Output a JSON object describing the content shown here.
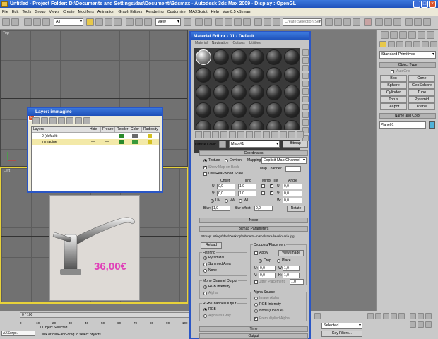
{
  "app": {
    "title": "Untitled   - Project Folder: D:\\Documents and Settings\\das\\Documenti\\3dsmax   - Autodesk 3ds Max  2009   - Display : OpenGL"
  },
  "menu": [
    "File",
    "Edit",
    "Tools",
    "Group",
    "Views",
    "Create",
    "Modifiers",
    "Animation",
    "Graph Editors",
    "Rendering",
    "Customize",
    "MAXScript",
    "Help",
    "Vue 8.5 xStream"
  ],
  "toolbar": {
    "filter_value": "All",
    "view_value": "View",
    "selection_set_placeholder": "Create Selection Set"
  },
  "viewports": {
    "top_label": "Top",
    "left_label": "Left"
  },
  "product": {
    "price": "36,00€"
  },
  "command_panel": {
    "category": "Standard Primitives",
    "object_type_title": "Object Type",
    "autogrid": "AutoGrid",
    "buttons": [
      "Box",
      "Cone",
      "Sphere",
      "GeoSphere",
      "Cylinder",
      "Tube",
      "Torus",
      "Pyramid",
      "Teapot",
      "Plane"
    ],
    "name_color_title": "Name and Color",
    "name_value": "Plane01"
  },
  "material_editor": {
    "title": "Material Editor - 01 - Default",
    "menu": [
      "Material",
      "Navigation",
      "Options",
      "Utilities"
    ],
    "diffuse_label": "Diffuse Color:",
    "map_value": "Map #1",
    "bitmap_type": "Bitmap",
    "coordinates": {
      "title": "Coordinates",
      "texture": "Texture",
      "environ": "Environ",
      "mapping_label": "Mapping:",
      "mapping_value": "Explicit Map Channel",
      "show_map_on_back": "Show Map on Back",
      "map_channel_label": "Map Channel:",
      "map_channel_value": "1",
      "use_real_world": "Use Real-World Scale",
      "offset_label": "Offset",
      "tiling_label": "Tiling",
      "mirror_tile_label": "Mirror Tile",
      "angle_label": "Angle",
      "u_offset": "0,0",
      "v_offset": "0,0",
      "u_tiling": "1,0",
      "v_tiling": "1,0",
      "u_angle": "0,0",
      "v_angle": "0,0",
      "w_angle": "0,0",
      "u": "U:",
      "v": "V:",
      "w": "W:",
      "uv": "UV",
      "vw": "VW",
      "wu": "WU",
      "blur_label": "Blur:",
      "blur_value": "1,0",
      "blur_offset_label": "Blur offset:",
      "blur_offset_value": "0,0",
      "rotate": "Rotate"
    },
    "noise_title": "Noise",
    "bitmap_params": {
      "title": "Bitmap Parameters",
      "bitmap_path": "Bitmap:  ettings\\das\\Desktop\\rubinetto-miscelatore-lavello-aria.jpg",
      "reload": "Reload",
      "cropping_title": "Cropping/Placement",
      "apply": "Apply",
      "view_image": "View Image",
      "crop": "Crop",
      "place": "Place",
      "u_label": "U:",
      "w_label": "W:",
      "v_label": "V:",
      "h_label": "H:",
      "u_value": "0,0",
      "w_value": "1,0",
      "v_value": "0,0",
      "h_value": "1,0",
      "jitter": "Jitter Placement:",
      "jitter_value": "1,0",
      "filtering_title": "Filtering",
      "pyramidal": "Pyramidal",
      "summed_area": "Summed Area",
      "none": "None",
      "mono_title": "Mono Channel Output",
      "rgb_intensity": "RGB Intensity",
      "alpha": "Alpha",
      "rgb_channel_title": "RGB Channel Output",
      "rgb": "RGB",
      "alpha_as_gray": "Alpha as Gray",
      "alpha_source_title": "Alpha Source",
      "image_alpha": "Image Alpha",
      "rgb_intensity2": "RGB Intensity",
      "none_opaque": "None (Opaque)",
      "premultiplied": "Premultiplied Alpha"
    },
    "time_title": "Time",
    "output_title": "Output"
  },
  "layer_window": {
    "title": "Layer: immagine",
    "columns": [
      "Layers",
      "Hide",
      "Freeze",
      "Render",
      "Color",
      "Radiosity"
    ],
    "rows": [
      {
        "name": "0 (default)",
        "hide": "—",
        "freeze": "—"
      },
      {
        "name": "immagine",
        "hide": "—",
        "freeze": "—"
      }
    ]
  },
  "status": {
    "frame": "0 / 100",
    "maxscript": "AXScript.",
    "objects_selected": "1 Object Selected",
    "prompt": "Click or click-and-drag to select objects",
    "selected": "Selected",
    "key_filters": "Key Filters...",
    "timeline_ticks": [
      "0",
      "10",
      "20",
      "30",
      "40",
      "50",
      "60",
      "70",
      "80",
      "90",
      "100"
    ]
  }
}
